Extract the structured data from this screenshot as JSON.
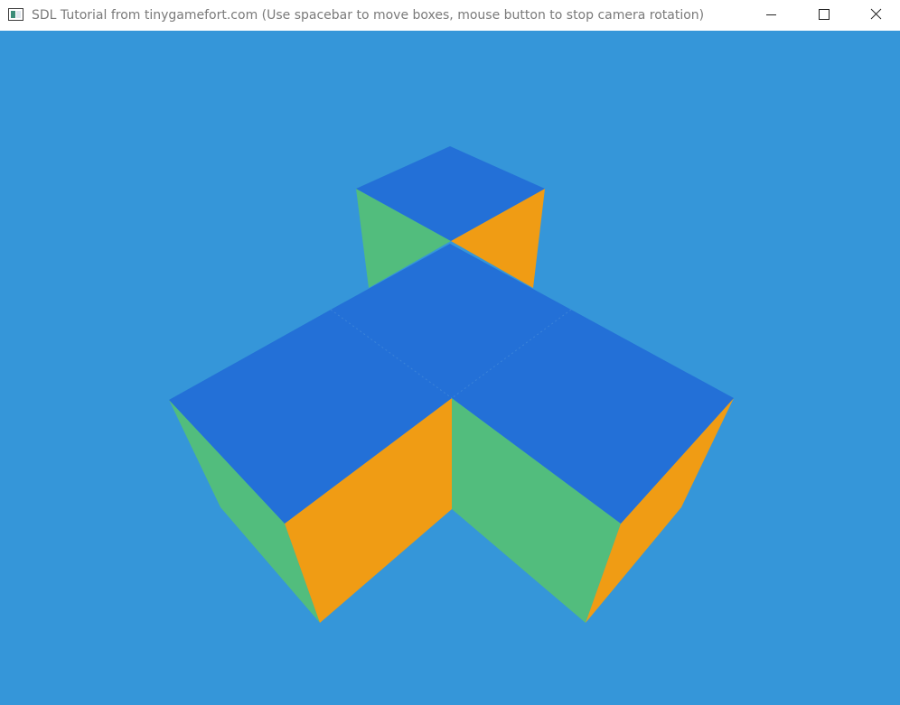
{
  "window": {
    "title": "SDL Tutorial from tinygamefort.com (Use spacebar to move boxes, mouse button to stop camera rotation)",
    "controls": [
      "minimize",
      "maximize",
      "close"
    ]
  },
  "scene": {
    "background_color": "#3596d9",
    "box_count": 4,
    "face_colors": {
      "top": "#2370d7",
      "left_side": "#52bd7d",
      "right_side": "#f09c14"
    }
  }
}
